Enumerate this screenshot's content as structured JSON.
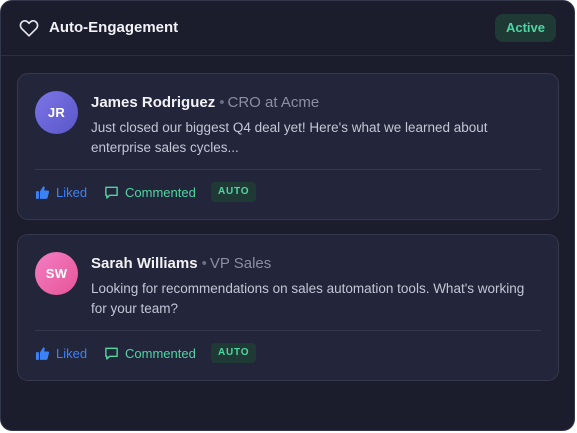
{
  "header": {
    "title": "Auto-Engagement",
    "icon": "heart-icon",
    "status": "Active"
  },
  "colors": {
    "background": "#1b1c2c",
    "card": "#23253a",
    "accent_green": "#4cd6a2",
    "accent_blue": "#3b82f6"
  },
  "posts": [
    {
      "initials": "JR",
      "name": "James Rodriguez",
      "role": "CRO at Acme",
      "text": "Just closed our biggest Q4 deal yet! Here's what we learned about enterprise sales cycles...",
      "liked_label": "Liked",
      "commented_label": "Commented",
      "badge": "AUTO"
    },
    {
      "initials": "SW",
      "name": "Sarah Williams",
      "role": "VP Sales",
      "text": "Looking for recommendations on sales automation tools. What's working for your team?",
      "liked_label": "Liked",
      "commented_label": "Commented",
      "badge": "AUTO"
    }
  ]
}
